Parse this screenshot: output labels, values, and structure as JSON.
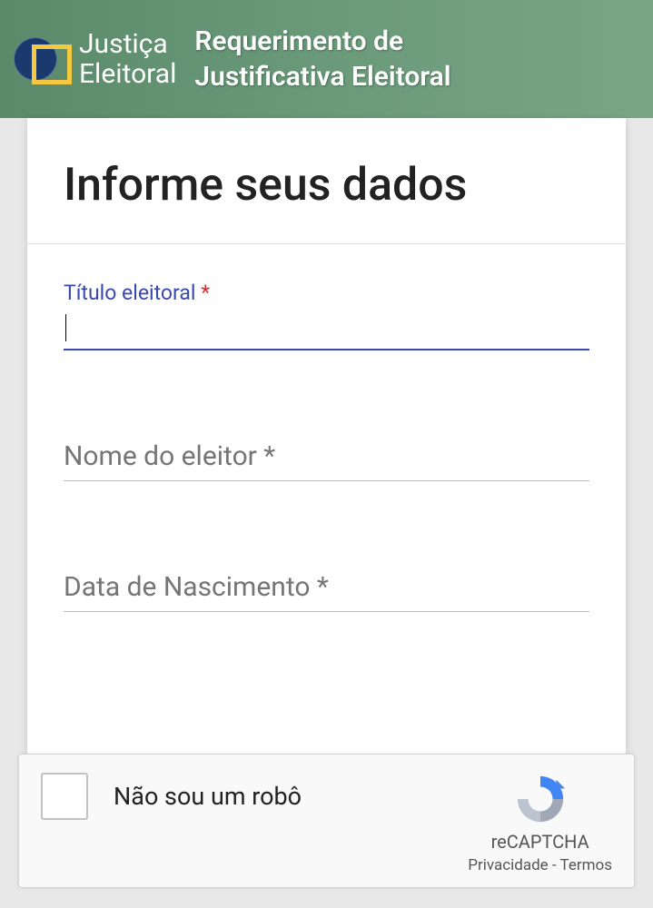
{
  "header": {
    "logo_line1": "Justiça",
    "logo_line2": "Eleitoral",
    "title_line1": "Requerimento de",
    "title_line2": "Justificativa Eleitoral"
  },
  "form": {
    "title": "Informe seus dados",
    "fields": {
      "titulo": {
        "label": "Título eleitoral ",
        "required": "*",
        "value": ""
      },
      "nome": {
        "label": "Nome do eleitor *",
        "value": ""
      },
      "data_nascimento": {
        "label": "Data de Nascimento *",
        "value": ""
      }
    }
  },
  "recaptcha": {
    "label": "Não sou um robô",
    "brand": "reCAPTCHA",
    "privacy": "Privacidade",
    "separator": " - ",
    "terms": "Termos"
  }
}
